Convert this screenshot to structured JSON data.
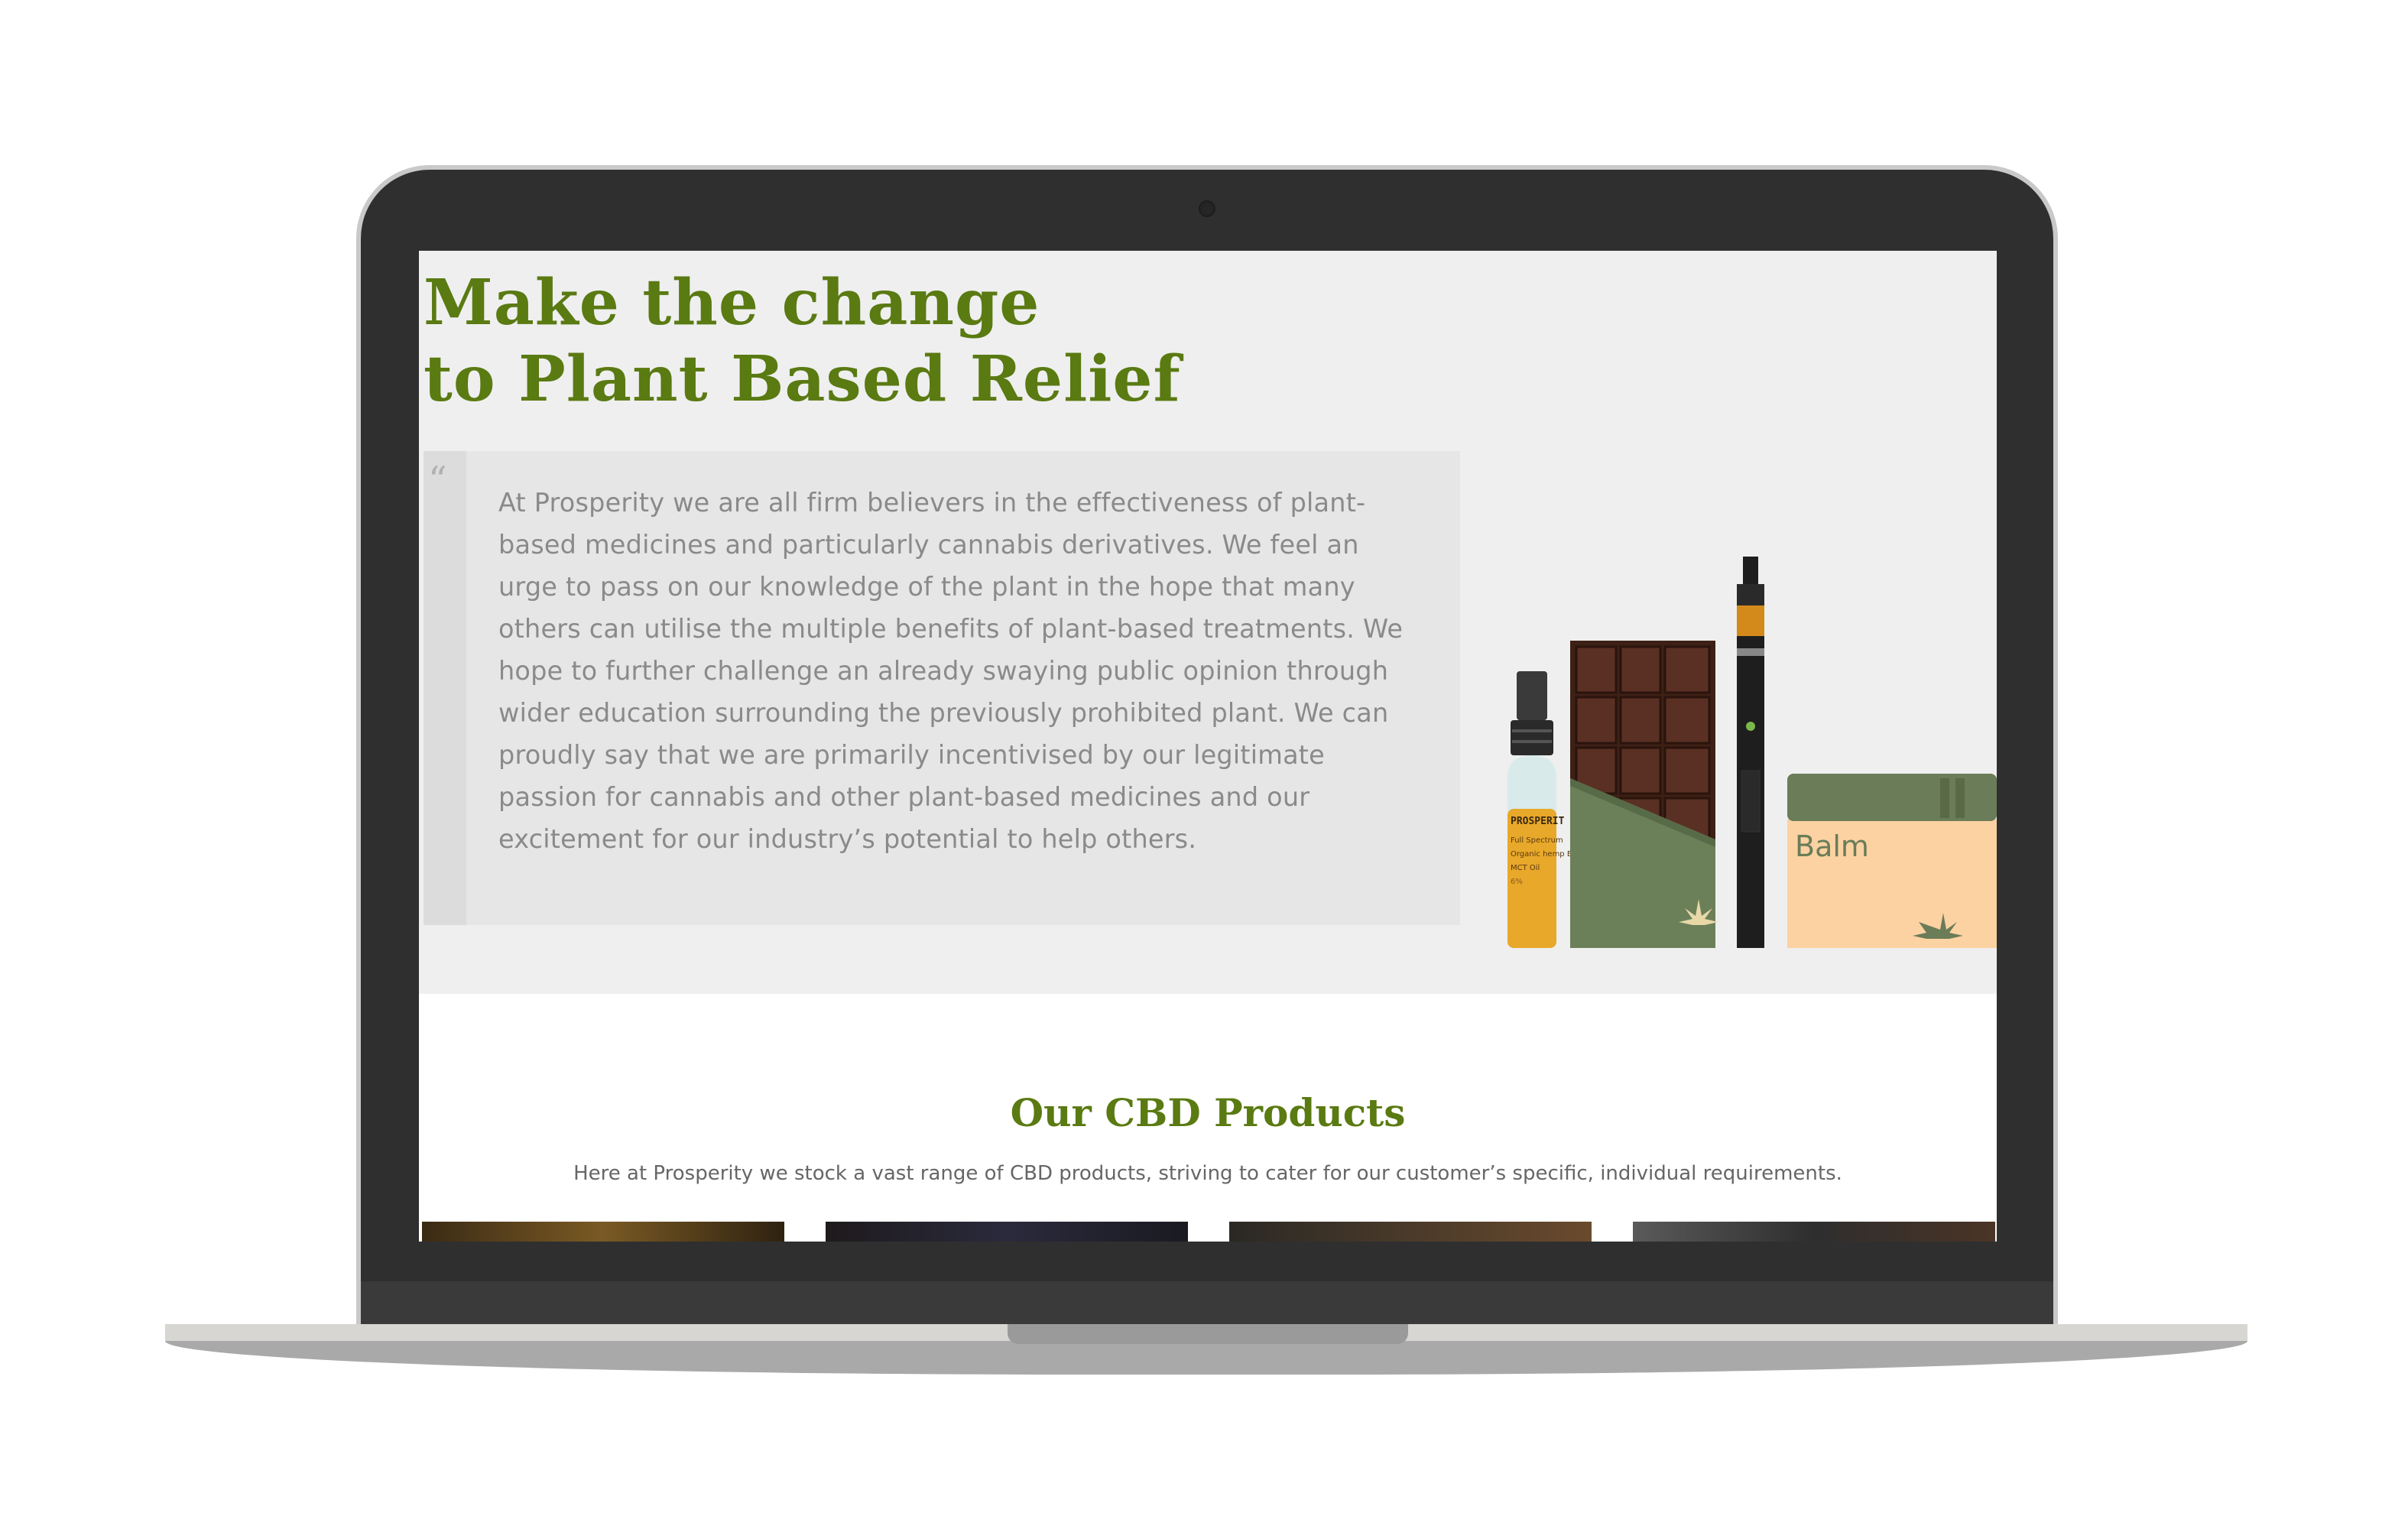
{
  "hero": {
    "headline_line1": "Make the change",
    "headline_line2": "to Plant Based Relief",
    "quote_mark": "“",
    "quote": "At Prosperity we are all firm believers in the effectiveness of plant-based medicines and particularly cannabis derivatives. We feel an urge to pass on our knowledge of the plant in the hope that many others can utilise the multiple benefits of plant-based treatments. We hope to further challenge an already swaying public opinion through wider education surrounding the previously prohibited plant. We can proudly say that we are primarily incentivised by our legitimate passion for cannabis and other plant-based medicines and our excitement for our industry’s potential to help others."
  },
  "illustration": {
    "bottle_brand": "PROSPERIT",
    "bottle_line1": "Full Spectrum",
    "bottle_line2": "Organic hemp Ex",
    "bottle_line3": "MCT Oil",
    "bottle_line4": "6%",
    "balm_label": "Balm"
  },
  "products_section": {
    "title": "Our CBD Products",
    "subtitle": "Here at Prosperity we stock a vast range of CBD products, striving to cater for our customer’s specific, individual requirements."
  },
  "colors": {
    "brand_green": "#5a7a12",
    "hero_bg": "#efefef",
    "quote_bg": "#e6e6e6"
  }
}
